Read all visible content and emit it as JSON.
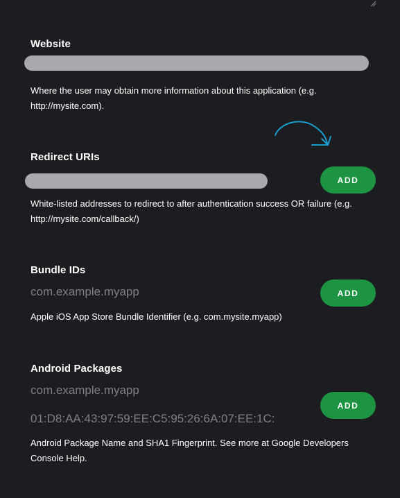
{
  "website": {
    "label": "Website",
    "value": "",
    "help": "Where the user may obtain more information about this application (e.g. http://mysite.com)."
  },
  "redirect": {
    "label": "Redirect URIs",
    "value": "",
    "add_label": "ADD",
    "help": "White-listed addresses to redirect to after authentication success OR failure (e.g. http://mysite.com/callback/)"
  },
  "bundle": {
    "label": "Bundle IDs",
    "placeholder": "com.example.myapp",
    "add_label": "ADD",
    "help": "Apple iOS App Store Bundle Identifier (e.g. com.mysite.myapp)"
  },
  "android": {
    "label": "Android Packages",
    "package_placeholder": "com.example.myapp",
    "fingerprint_placeholder": "01:D8:AA:43:97:59:EE:C5:95:26:6A:07:EE:1C:",
    "add_label": "ADD",
    "help": "Android Package Name and SHA1 Fingerprint. See more at Google Developers Console Help."
  },
  "colors": {
    "background": "#1c1d21",
    "add_button": "#1d9441",
    "input_fill": "#a8a9ac",
    "annotation_arrow": "#1a9ccc"
  },
  "icons": {
    "resize": "resize-grip-icon",
    "annotation": "curved-arrow-icon"
  }
}
